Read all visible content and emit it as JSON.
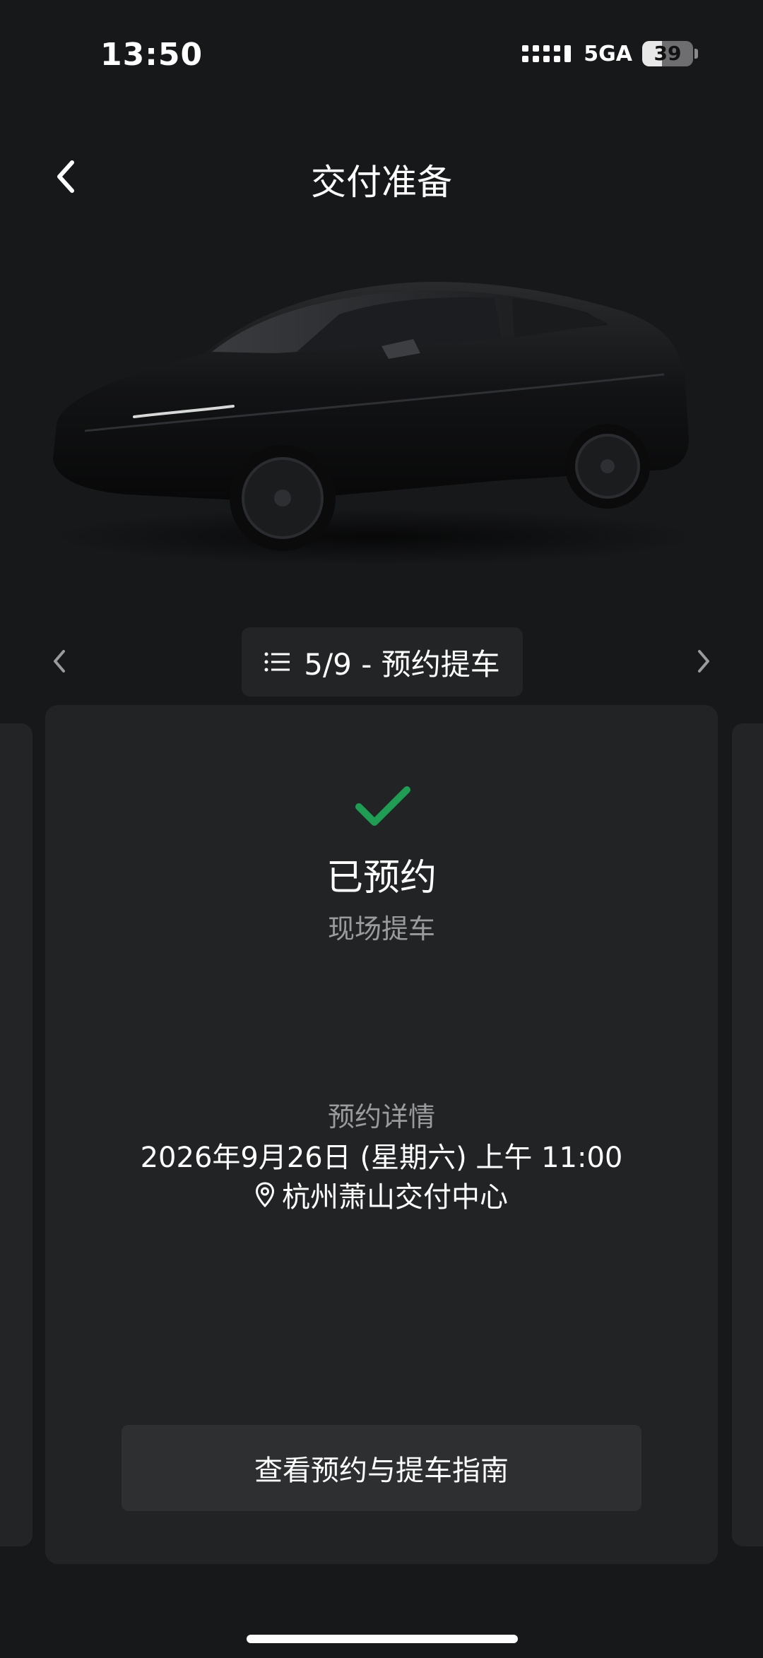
{
  "status_bar": {
    "time": "13:50",
    "network": "5GA",
    "battery_level": 39,
    "battery_text": "39",
    "signal_icon": "signal-dots-icon"
  },
  "nav": {
    "title": "交付准备",
    "back_icon": "chevron-left-icon"
  },
  "car": {
    "image_icon": "car-image",
    "color": "#101112"
  },
  "step_selector": {
    "label": "5/9 - 预约提车",
    "list_icon": "list-icon",
    "prev_icon": "chevron-left-icon",
    "next_icon": "chevron-right-icon"
  },
  "card": {
    "status_icon": "check-icon",
    "status_color": "#1f9d55",
    "status_title": "已预约",
    "status_subtitle": "现场提车",
    "details_label": "预约详情",
    "datetime": "2026年9月26日 (星期六) 上午 11:00",
    "location_icon": "location-pin-icon",
    "location": "杭州萧山交付中心",
    "guide_button": "查看预约与提车指南"
  }
}
